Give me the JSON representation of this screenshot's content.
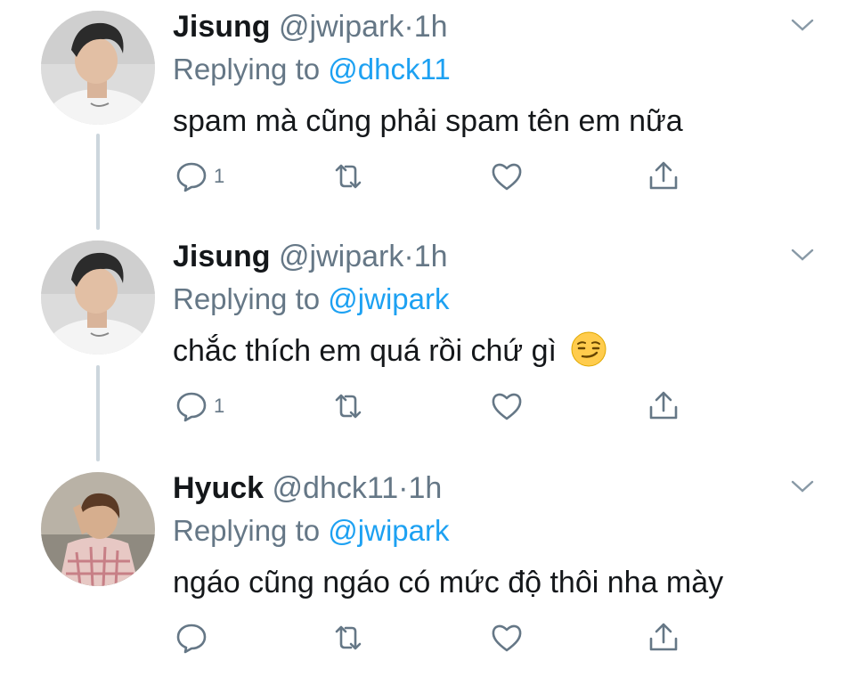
{
  "tweets": [
    {
      "name": "Jisung",
      "handle": "@jwipark",
      "dot": "·",
      "time": "1h",
      "replying_prefix": "Replying to",
      "replying_to": "@dhck11",
      "text": "spam mà cũng phải spam tên em nữa",
      "reply_count": "1",
      "avatar_icon": "avatar-jisung",
      "emoji": ""
    },
    {
      "name": "Jisung",
      "handle": "@jwipark",
      "dot": "·",
      "time": "1h",
      "replying_prefix": "Replying to",
      "replying_to": "@jwipark",
      "text": "chắc thích em quá rồi chứ gì",
      "reply_count": "1",
      "avatar_icon": "avatar-jisung",
      "emoji": "smirking-face"
    },
    {
      "name": "Hyuck",
      "handle": "@dhck11",
      "dot": "·",
      "time": "1h",
      "replying_prefix": "Replying to",
      "replying_to": "@jwipark",
      "text": "ngáo cũng ngáo có mức độ thôi nha mày",
      "reply_count": "",
      "avatar_icon": "avatar-hyuck",
      "emoji": ""
    }
  ],
  "colors": {
    "accent": "#1da1f2",
    "secondary_text": "#657786",
    "thread_line": "#ccd6dd",
    "icon": "#657786"
  }
}
